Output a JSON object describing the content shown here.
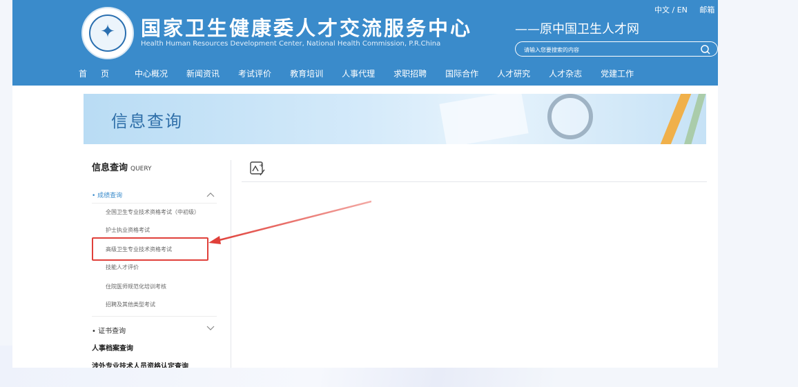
{
  "header": {
    "title": "国家卫生健康委人才交流服务中心",
    "subtitle": "Health Human Resources Development Center, National Health Commission, P.R.China",
    "old_name": "——原中国卫生人才网",
    "lang": "中文 / EN",
    "mail": "邮箱",
    "search_placeholder": "请输入您要搜索的内容",
    "brand_color": "#3a8bcb"
  },
  "nav": [
    "首页",
    "中心概况",
    "新闻资讯",
    "考试评价",
    "教育培训",
    "人事代理",
    "求职招聘",
    "国际合作",
    "人才研究",
    "人才杂志",
    "党建工作"
  ],
  "banner": {
    "title": "信息查询"
  },
  "sidebar": {
    "heading": "信息查询",
    "heading_en": "QUERY",
    "group1": "• 成绩查询",
    "items": [
      "全国卫生专业技术资格考试（中初级）",
      "护士执业资格考试",
      "高级卫生专业技术资格考试",
      "技能人才评价",
      "住院医师规范化培训考核",
      "招聘及其他类型考试"
    ],
    "group2": "• 证书查询",
    "bold1": "人事档案查询",
    "bold2": "涉外专业技术人员资格认定查询"
  },
  "annotation_color": "#e0403a"
}
